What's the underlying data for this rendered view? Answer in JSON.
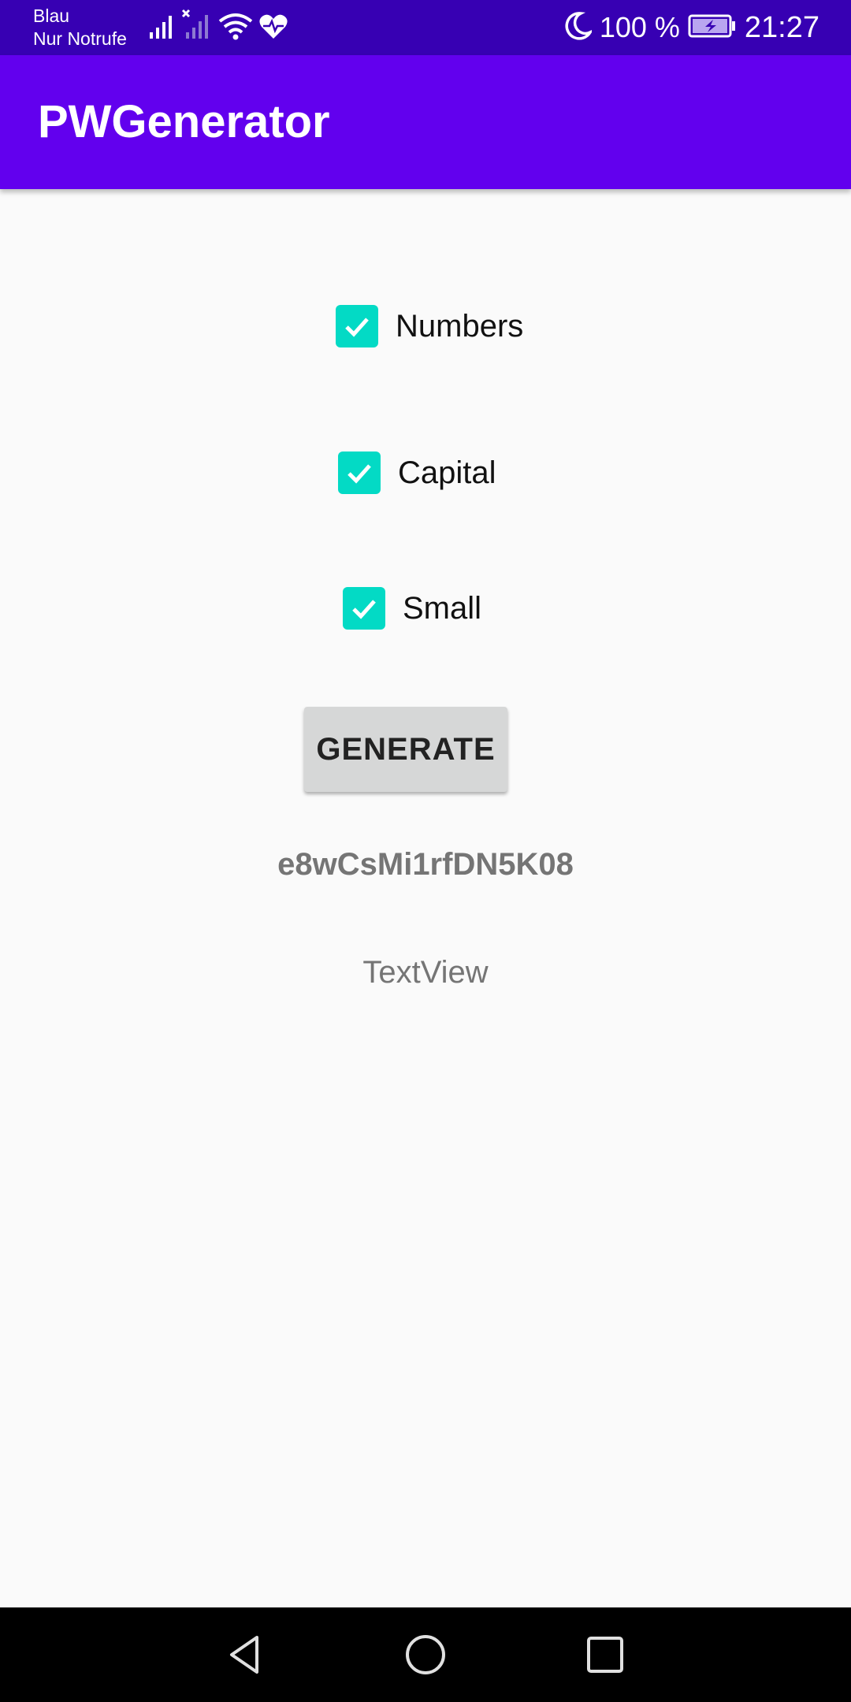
{
  "status_bar": {
    "carrier_line1": "Blau",
    "carrier_line2": "Nur Notrufe",
    "battery_percent": "100 %",
    "time": "21:27",
    "icons": [
      "signal-icon",
      "no-signal-icon",
      "wifi-icon",
      "health-icon",
      "moon-icon",
      "battery-charging-icon"
    ],
    "background": "#3700b3"
  },
  "app_bar": {
    "title": "PWGenerator",
    "background": "#6200ee"
  },
  "options": [
    {
      "label": "Numbers",
      "checked": true
    },
    {
      "label": "Capital",
      "checked": true
    },
    {
      "label": "Small",
      "checked": true
    }
  ],
  "accent_color": "#03dac5",
  "generate_button": {
    "label": "GENERATE"
  },
  "password_output": "e8wCsMi1rfDN5K08",
  "textview": "TextView",
  "nav_bar": {
    "icons": [
      "back-icon",
      "home-icon",
      "recents-icon"
    ]
  }
}
